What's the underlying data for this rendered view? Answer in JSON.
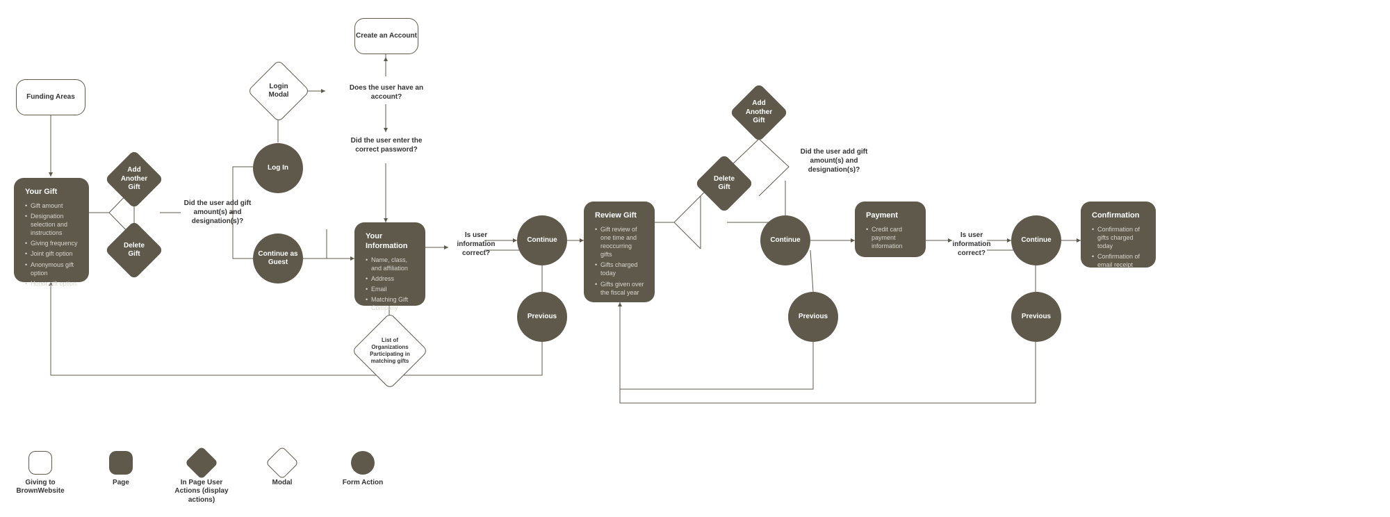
{
  "funding_areas": "Funding Areas",
  "create_account": "Create an Account",
  "login_modal": "Login Modal",
  "list_orgs": "List of Organizations Participating in matching gifts",
  "your_gift": {
    "title": "Your Gift",
    "items": [
      "Gift amount",
      "Designation selection and instructions",
      "Giving frequency",
      "Joint gift option",
      "Anonymous gift option",
      "Honor gift option"
    ]
  },
  "your_info": {
    "title": "Your Information",
    "items": [
      "Name, class, and affiliation",
      "Address",
      "Email",
      "Matching Gift Company"
    ]
  },
  "review_gift": {
    "title": "Review Gift",
    "items": [
      "Gift review of one time and reoccurring gifts",
      "Gifts charged today",
      "Gifts given over the fiscal year"
    ]
  },
  "payment": {
    "title": "Payment",
    "items": [
      "Credit card payment information"
    ]
  },
  "confirmation": {
    "title": "Confirmation",
    "items": [
      "Confirmation of gifts charged today",
      "Confirmation of email receipt"
    ]
  },
  "add_gift": "Add Another Gift",
  "delete_gift": "Delete Gift",
  "log_in": "Log In",
  "continue_guest": "Continue as Guest",
  "continue": "Continue",
  "previous": "Previous",
  "q_amounts": "Did the user add gift amount(s) and designation(s)?",
  "q_account": "Does the user have an account?",
  "q_password": "Did the user enter the correct password?",
  "q_info": "Is user information correct?",
  "legend": {
    "site": "Giving to BrownWebsite",
    "page": "Page",
    "inpage": "In Page User Actions (display actions)",
    "modal": "Modal",
    "action": "Form Action"
  }
}
